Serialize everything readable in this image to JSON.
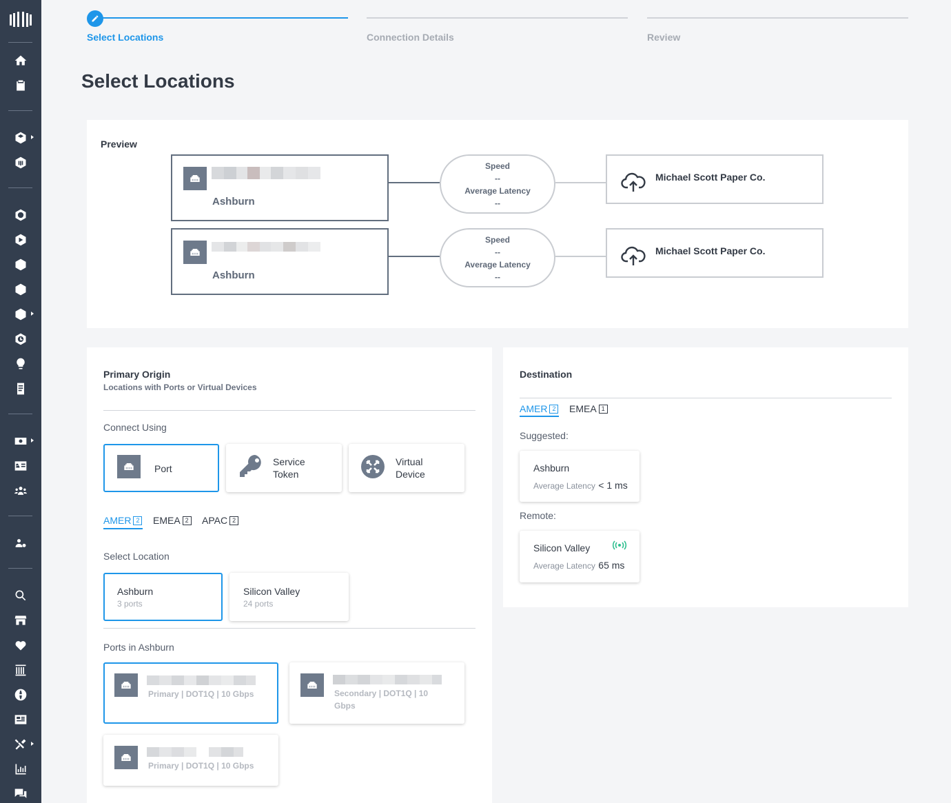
{
  "stepper": {
    "steps": [
      {
        "label": "Select Locations"
      },
      {
        "label": "Connection Details"
      },
      {
        "label": "Review"
      }
    ]
  },
  "page": {
    "title": "Select Locations"
  },
  "preview": {
    "title": "Preview",
    "rows": [
      {
        "origin": "Ashburn",
        "speed_label": "Speed",
        "speed_value": "--",
        "latency_label": "Average Latency",
        "latency_value": "--",
        "destination": "Michael Scott Paper Co."
      },
      {
        "origin": "Ashburn",
        "speed_label": "Speed",
        "speed_value": "--",
        "latency_label": "Average Latency",
        "latency_value": "--",
        "destination": "Michael Scott Paper Co."
      }
    ]
  },
  "primary_origin": {
    "title": "Primary Origin",
    "subtitle": "Locations with Ports or Virtual Devices",
    "connect_using_label": "Connect Using",
    "connect_options": [
      {
        "line1": "Port",
        "line2": ""
      },
      {
        "line1": "Service",
        "line2": "Token"
      },
      {
        "line1": "Virtual",
        "line2": "Device"
      }
    ],
    "region_tabs": [
      {
        "label": "AMER",
        "count": "2"
      },
      {
        "label": "EMEA",
        "count": "2"
      },
      {
        "label": "APAC",
        "count": "2"
      }
    ],
    "select_location_label": "Select Location",
    "locations": [
      {
        "name": "Ashburn",
        "ports": "3 ports"
      },
      {
        "name": "Silicon Valley",
        "ports": "24 ports"
      }
    ],
    "ports_label": "Ports in Ashburn",
    "ports": [
      {
        "info": "Primary | DOT1Q | 10 Gbps"
      },
      {
        "info_line1": "Secondary | DOT1Q | 10",
        "info_line2": "Gbps"
      },
      {
        "info": "Primary | DOT1Q | 10 Gbps"
      }
    ]
  },
  "destination": {
    "title": "Destination",
    "region_tabs": [
      {
        "label": "AMER",
        "count": "2"
      },
      {
        "label": "EMEA",
        "count": "1"
      }
    ],
    "suggested_label": "Suggested:",
    "suggested": {
      "name": "Ashburn",
      "latency_label": "Average Latency",
      "latency_value": "< 1 ms"
    },
    "remote_label": "Remote:",
    "remote": {
      "name": "Silicon Valley",
      "latency_label": "Average Latency",
      "latency_value": "65 ms"
    }
  },
  "sidebar": {
    "icons": [
      "equinix-logo-icon",
      "home-icon",
      "clipboard-icon",
      "layers-icon",
      "building-icon",
      "fabric-icon",
      "network-icon",
      "stack-icon",
      "globe-icon",
      "exchange-icon",
      "clock-icon",
      "lightbulb-icon",
      "document-icon",
      "billing-icon",
      "contacts-icon",
      "users-icon",
      "user-settings-icon",
      "search-icon",
      "store-icon",
      "health-icon",
      "columns-icon",
      "world-icon",
      "news-icon",
      "tools-icon",
      "reports-icon",
      "chat-icon"
    ]
  },
  "colors": {
    "accent": "#1e96e9",
    "sidebar": "#333e4e",
    "signal": "#2fbf8f"
  }
}
